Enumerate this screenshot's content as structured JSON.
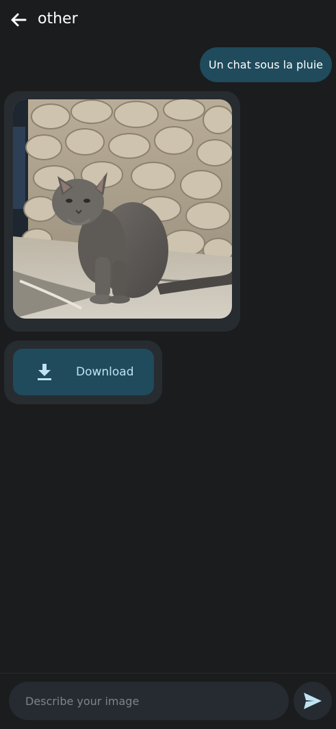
{
  "header": {
    "back_icon": "arrow-left-icon",
    "title": "other"
  },
  "conversation": {
    "user_message": "Un chat sous la pluie",
    "generated_image": {
      "subject": "gray tabby cat sitting on a wet stone ledge in front of a stone wall"
    },
    "download": {
      "icon": "download-icon",
      "label": "Download"
    }
  },
  "composer": {
    "placeholder": "Describe your image",
    "value": "",
    "send_icon": "send-icon"
  },
  "colors": {
    "background": "#1b1c1e",
    "bubble": "#272c31",
    "accent": "#1f4b5c",
    "accent_text": "#bfe3f2",
    "input_bg": "#252b30"
  }
}
